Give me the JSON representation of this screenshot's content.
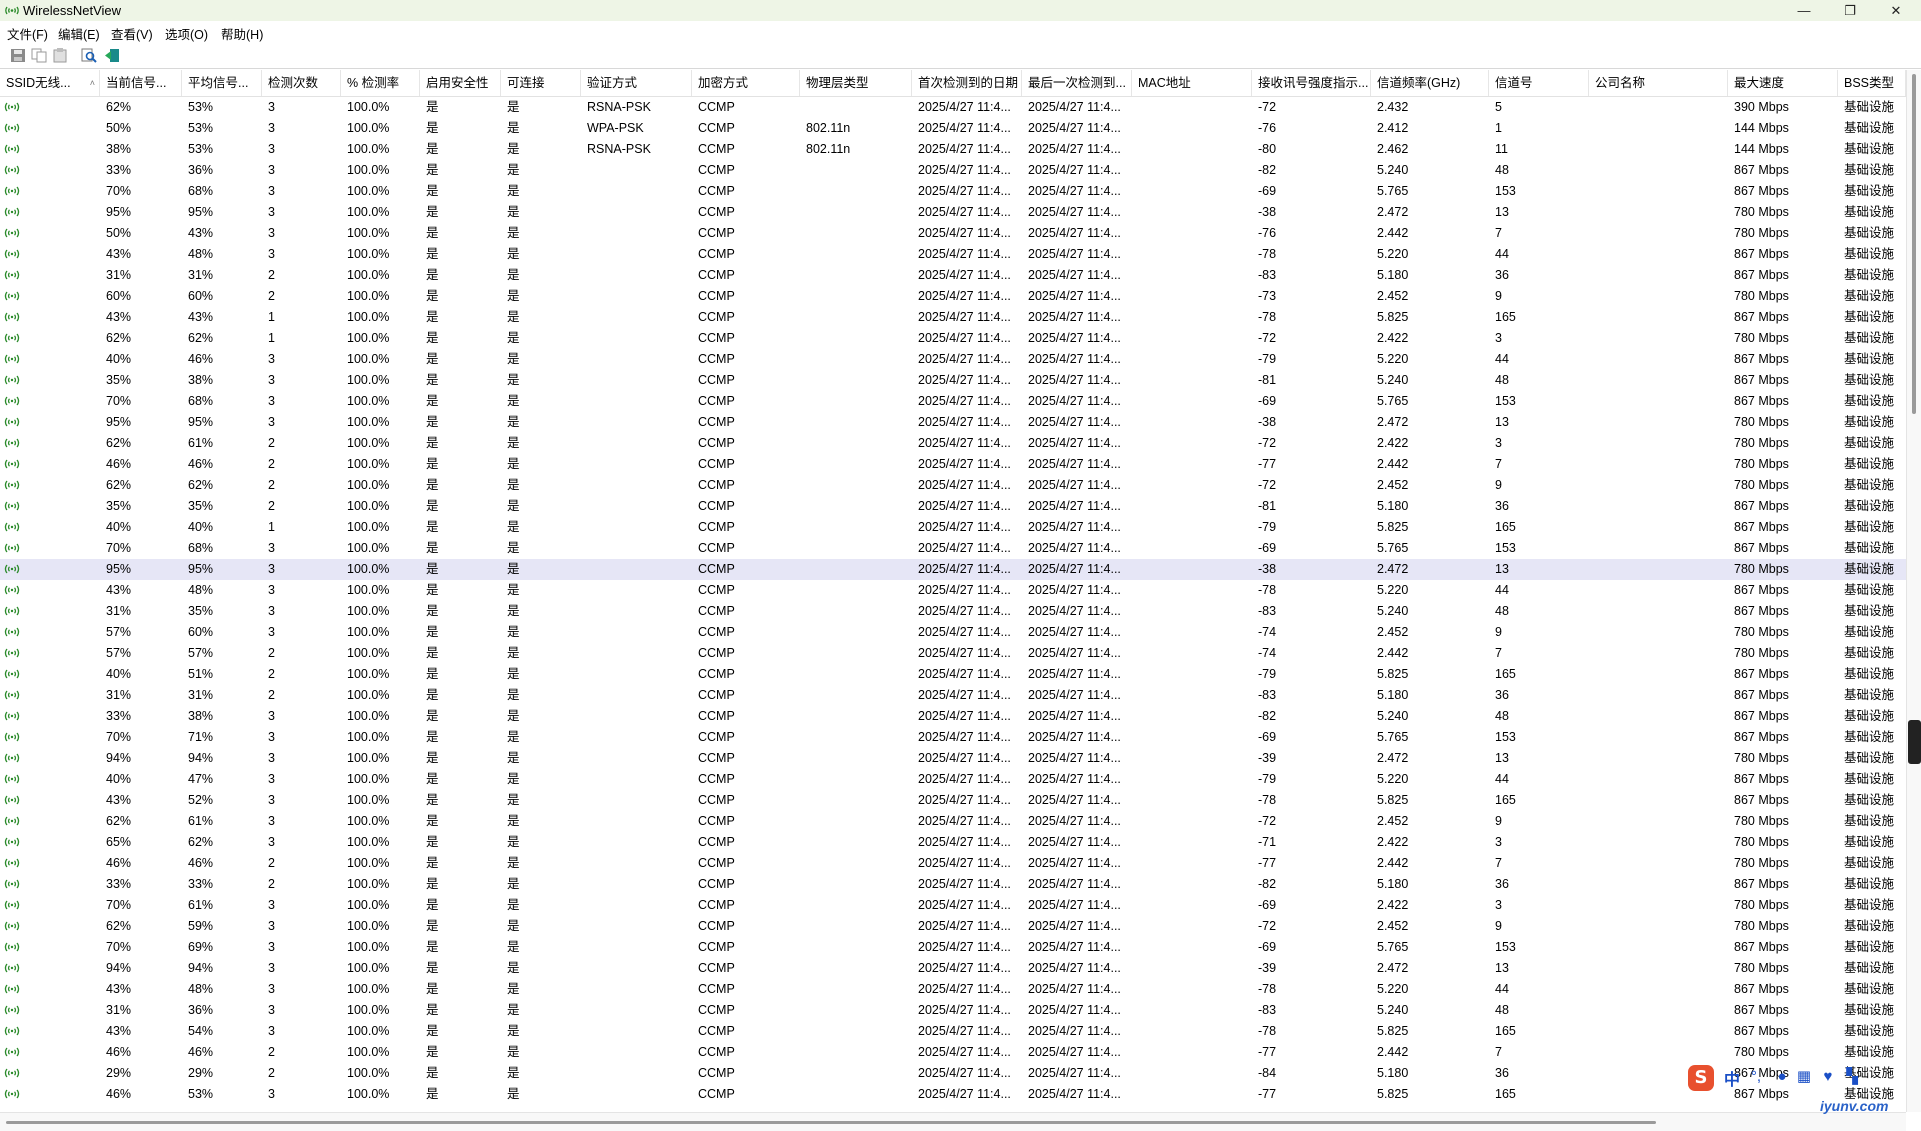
{
  "window": {
    "title": "WirelessNetView",
    "controls": {
      "minimize": "—",
      "maximize": "❐",
      "close": "✕"
    }
  },
  "menu": [
    "文件(F)",
    "编辑(E)",
    "查看(V)",
    "选项(O)",
    "帮助(H)"
  ],
  "toolbar": [
    "save-icon",
    "copy-icon",
    "properties-icon",
    "find-icon",
    "exit-icon"
  ],
  "columns": [
    "SSID无线...",
    "当前信号...",
    "平均信号...",
    "检测次数",
    "% 检测率",
    "启用安全性",
    "可连接",
    "验证方式",
    "加密方式",
    "物理层类型",
    "首次检测到的日期",
    "最后一次检测到...",
    "MAC地址",
    "接收讯号强度指示...",
    "信道频率(GHz)",
    "信道号",
    "公司名称",
    "最大速度",
    "BSS类型"
  ],
  "sort_indicator": "˄",
  "row_constants": {
    "rate": "100.0%",
    "security": "是",
    "connectable": "是",
    "first": "2025/4/27 11:4...",
    "last": "2025/4/27 11:4...",
    "bss": "基础设施"
  },
  "rows": [
    {
      "ssid": "",
      "cur": "62%",
      "avg": "53%",
      "cnt": "3",
      "auth": "RSNA-PSK",
      "enc": "CCMP",
      "phy": "",
      "rssi": "-72",
      "freq": "2.432",
      "ch": "5",
      "speed": "390 Mbps"
    },
    {
      "ssid": "",
      "cur": "50%",
      "avg": "53%",
      "cnt": "3",
      "auth": "WPA-PSK",
      "enc": "CCMP",
      "phy": "802.11n",
      "rssi": "-76",
      "freq": "2.412",
      "ch": "1",
      "speed": "144 Mbps"
    },
    {
      "ssid": "",
      "cur": "38%",
      "avg": "53%",
      "cnt": "3",
      "auth": "RSNA-PSK",
      "enc": "CCMP",
      "phy": "802.11n",
      "rssi": "-80",
      "freq": "2.462",
      "ch": "11",
      "speed": "144 Mbps"
    },
    {
      "ssid": "",
      "cur": "33%",
      "avg": "36%",
      "cnt": "3",
      "auth": "",
      "enc": "CCMP",
      "phy": "",
      "rssi": "-82",
      "freq": "5.240",
      "ch": "48",
      "speed": "867 Mbps"
    },
    {
      "ssid": "",
      "cur": "70%",
      "avg": "68%",
      "cnt": "3",
      "auth": "",
      "enc": "CCMP",
      "phy": "",
      "rssi": "-69",
      "freq": "5.765",
      "ch": "153",
      "speed": "867 Mbps"
    },
    {
      "ssid": "",
      "cur": "95%",
      "avg": "95%",
      "cnt": "3",
      "auth": "",
      "enc": "CCMP",
      "phy": "",
      "rssi": "-38",
      "freq": "2.472",
      "ch": "13",
      "speed": "780 Mbps"
    },
    {
      "ssid": "",
      "cur": "50%",
      "avg": "43%",
      "cnt": "3",
      "auth": "",
      "enc": "CCMP",
      "phy": "",
      "rssi": "-76",
      "freq": "2.442",
      "ch": "7",
      "speed": "780 Mbps"
    },
    {
      "ssid": "",
      "cur": "43%",
      "avg": "48%",
      "cnt": "3",
      "auth": "",
      "enc": "CCMP",
      "phy": "",
      "rssi": "-78",
      "freq": "5.220",
      "ch": "44",
      "speed": "867 Mbps"
    },
    {
      "ssid": "",
      "cur": "31%",
      "avg": "31%",
      "cnt": "2",
      "auth": "",
      "enc": "CCMP",
      "phy": "",
      "rssi": "-83",
      "freq": "5.180",
      "ch": "36",
      "speed": "867 Mbps"
    },
    {
      "ssid": "",
      "cur": "60%",
      "avg": "60%",
      "cnt": "2",
      "auth": "",
      "enc": "CCMP",
      "phy": "",
      "rssi": "-73",
      "freq": "2.452",
      "ch": "9",
      "speed": "780 Mbps"
    },
    {
      "ssid": "",
      "cur": "43%",
      "avg": "43%",
      "cnt": "1",
      "auth": "",
      "enc": "CCMP",
      "phy": "",
      "rssi": "-78",
      "freq": "5.825",
      "ch": "165",
      "speed": "867 Mbps"
    },
    {
      "ssid": "",
      "cur": "62%",
      "avg": "62%",
      "cnt": "1",
      "auth": "",
      "enc": "CCMP",
      "phy": "",
      "rssi": "-72",
      "freq": "2.422",
      "ch": "3",
      "speed": "780 Mbps"
    },
    {
      "ssid": "",
      "cur": "40%",
      "avg": "46%",
      "cnt": "3",
      "auth": "",
      "enc": "CCMP",
      "phy": "",
      "rssi": "-79",
      "freq": "5.220",
      "ch": "44",
      "speed": "867 Mbps"
    },
    {
      "ssid": "",
      "cur": "35%",
      "avg": "38%",
      "cnt": "3",
      "auth": "",
      "enc": "CCMP",
      "phy": "",
      "rssi": "-81",
      "freq": "5.240",
      "ch": "48",
      "speed": "867 Mbps"
    },
    {
      "ssid": "",
      "cur": "70%",
      "avg": "68%",
      "cnt": "3",
      "auth": "",
      "enc": "CCMP",
      "phy": "",
      "rssi": "-69",
      "freq": "5.765",
      "ch": "153",
      "speed": "867 Mbps"
    },
    {
      "ssid": "",
      "cur": "95%",
      "avg": "95%",
      "cnt": "3",
      "auth": "",
      "enc": "CCMP",
      "phy": "",
      "rssi": "-38",
      "freq": "2.472",
      "ch": "13",
      "speed": "780 Mbps"
    },
    {
      "ssid": "",
      "cur": "62%",
      "avg": "61%",
      "cnt": "2",
      "auth": "",
      "enc": "CCMP",
      "phy": "",
      "rssi": "-72",
      "freq": "2.422",
      "ch": "3",
      "speed": "780 Mbps"
    },
    {
      "ssid": "",
      "cur": "46%",
      "avg": "46%",
      "cnt": "2",
      "auth": "",
      "enc": "CCMP",
      "phy": "",
      "rssi": "-77",
      "freq": "2.442",
      "ch": "7",
      "speed": "780 Mbps"
    },
    {
      "ssid": "",
      "cur": "62%",
      "avg": "62%",
      "cnt": "2",
      "auth": "",
      "enc": "CCMP",
      "phy": "",
      "rssi": "-72",
      "freq": "2.452",
      "ch": "9",
      "speed": "780 Mbps"
    },
    {
      "ssid": "",
      "cur": "35%",
      "avg": "35%",
      "cnt": "2",
      "auth": "",
      "enc": "CCMP",
      "phy": "",
      "rssi": "-81",
      "freq": "5.180",
      "ch": "36",
      "speed": "867 Mbps"
    },
    {
      "ssid": "",
      "cur": "40%",
      "avg": "40%",
      "cnt": "1",
      "auth": "",
      "enc": "CCMP",
      "phy": "",
      "rssi": "-79",
      "freq": "5.825",
      "ch": "165",
      "speed": "867 Mbps"
    },
    {
      "ssid": "",
      "cur": "70%",
      "avg": "68%",
      "cnt": "3",
      "auth": "",
      "enc": "CCMP",
      "phy": "",
      "rssi": "-69",
      "freq": "5.765",
      "ch": "153",
      "speed": "867 Mbps"
    },
    {
      "ssid": "",
      "cur": "95%",
      "avg": "95%",
      "cnt": "3",
      "auth": "",
      "enc": "CCMP",
      "phy": "",
      "rssi": "-38",
      "freq": "2.472",
      "ch": "13",
      "speed": "780 Mbps",
      "selected": true
    },
    {
      "ssid": "",
      "cur": "43%",
      "avg": "48%",
      "cnt": "3",
      "auth": "",
      "enc": "CCMP",
      "phy": "",
      "rssi": "-78",
      "freq": "5.220",
      "ch": "44",
      "speed": "867 Mbps"
    },
    {
      "ssid": "",
      "cur": "31%",
      "avg": "35%",
      "cnt": "3",
      "auth": "",
      "enc": "CCMP",
      "phy": "",
      "rssi": "-83",
      "freq": "5.240",
      "ch": "48",
      "speed": "867 Mbps"
    },
    {
      "ssid": "",
      "cur": "57%",
      "avg": "60%",
      "cnt": "3",
      "auth": "",
      "enc": "CCMP",
      "phy": "",
      "rssi": "-74",
      "freq": "2.452",
      "ch": "9",
      "speed": "780 Mbps"
    },
    {
      "ssid": "",
      "cur": "57%",
      "avg": "57%",
      "cnt": "2",
      "auth": "",
      "enc": "CCMP",
      "phy": "",
      "rssi": "-74",
      "freq": "2.442",
      "ch": "7",
      "speed": "780 Mbps"
    },
    {
      "ssid": "",
      "cur": "40%",
      "avg": "51%",
      "cnt": "2",
      "auth": "",
      "enc": "CCMP",
      "phy": "",
      "rssi": "-79",
      "freq": "5.825",
      "ch": "165",
      "speed": "867 Mbps"
    },
    {
      "ssid": "",
      "cur": "31%",
      "avg": "31%",
      "cnt": "2",
      "auth": "",
      "enc": "CCMP",
      "phy": "",
      "rssi": "-83",
      "freq": "5.180",
      "ch": "36",
      "speed": "867 Mbps"
    },
    {
      "ssid": "",
      "cur": "33%",
      "avg": "38%",
      "cnt": "3",
      "auth": "",
      "enc": "CCMP",
      "phy": "",
      "rssi": "-82",
      "freq": "5.240",
      "ch": "48",
      "speed": "867 Mbps"
    },
    {
      "ssid": "",
      "cur": "70%",
      "avg": "71%",
      "cnt": "3",
      "auth": "",
      "enc": "CCMP",
      "phy": "",
      "rssi": "-69",
      "freq": "5.765",
      "ch": "153",
      "speed": "867 Mbps"
    },
    {
      "ssid": "",
      "cur": "94%",
      "avg": "94%",
      "cnt": "3",
      "auth": "",
      "enc": "CCMP",
      "phy": "",
      "rssi": "-39",
      "freq": "2.472",
      "ch": "13",
      "speed": "780 Mbps"
    },
    {
      "ssid": "",
      "cur": "40%",
      "avg": "47%",
      "cnt": "3",
      "auth": "",
      "enc": "CCMP",
      "phy": "",
      "rssi": "-79",
      "freq": "5.220",
      "ch": "44",
      "speed": "867 Mbps"
    },
    {
      "ssid": "",
      "cur": "43%",
      "avg": "52%",
      "cnt": "3",
      "auth": "",
      "enc": "CCMP",
      "phy": "",
      "rssi": "-78",
      "freq": "5.825",
      "ch": "165",
      "speed": "867 Mbps"
    },
    {
      "ssid": "",
      "cur": "62%",
      "avg": "61%",
      "cnt": "3",
      "auth": "",
      "enc": "CCMP",
      "phy": "",
      "rssi": "-72",
      "freq": "2.452",
      "ch": "9",
      "speed": "780 Mbps"
    },
    {
      "ssid": "",
      "cur": "65%",
      "avg": "62%",
      "cnt": "3",
      "auth": "",
      "enc": "CCMP",
      "phy": "",
      "rssi": "-71",
      "freq": "2.422",
      "ch": "3",
      "speed": "780 Mbps"
    },
    {
      "ssid": "",
      "cur": "46%",
      "avg": "46%",
      "cnt": "2",
      "auth": "",
      "enc": "CCMP",
      "phy": "",
      "rssi": "-77",
      "freq": "2.442",
      "ch": "7",
      "speed": "780 Mbps"
    },
    {
      "ssid": "",
      "cur": "33%",
      "avg": "33%",
      "cnt": "2",
      "auth": "",
      "enc": "CCMP",
      "phy": "",
      "rssi": "-82",
      "freq": "5.180",
      "ch": "36",
      "speed": "867 Mbps"
    },
    {
      "ssid": "",
      "cur": "70%",
      "avg": "61%",
      "cnt": "3",
      "auth": "",
      "enc": "CCMP",
      "phy": "",
      "rssi": "-69",
      "freq": "2.422",
      "ch": "3",
      "speed": "780 Mbps"
    },
    {
      "ssid": "",
      "cur": "62%",
      "avg": "59%",
      "cnt": "3",
      "auth": "",
      "enc": "CCMP",
      "phy": "",
      "rssi": "-72",
      "freq": "2.452",
      "ch": "9",
      "speed": "780 Mbps"
    },
    {
      "ssid": "",
      "cur": "70%",
      "avg": "69%",
      "cnt": "3",
      "auth": "",
      "enc": "CCMP",
      "phy": "",
      "rssi": "-69",
      "freq": "5.765",
      "ch": "153",
      "speed": "867 Mbps"
    },
    {
      "ssid": "",
      "cur": "94%",
      "avg": "94%",
      "cnt": "3",
      "auth": "",
      "enc": "CCMP",
      "phy": "",
      "rssi": "-39",
      "freq": "2.472",
      "ch": "13",
      "speed": "780 Mbps"
    },
    {
      "ssid": "",
      "cur": "43%",
      "avg": "48%",
      "cnt": "3",
      "auth": "",
      "enc": "CCMP",
      "phy": "",
      "rssi": "-78",
      "freq": "5.220",
      "ch": "44",
      "speed": "867 Mbps"
    },
    {
      "ssid": "",
      "cur": "31%",
      "avg": "36%",
      "cnt": "3",
      "auth": "",
      "enc": "CCMP",
      "phy": "",
      "rssi": "-83",
      "freq": "5.240",
      "ch": "48",
      "speed": "867 Mbps"
    },
    {
      "ssid": "",
      "cur": "43%",
      "avg": "54%",
      "cnt": "3",
      "auth": "",
      "enc": "CCMP",
      "phy": "",
      "rssi": "-78",
      "freq": "5.825",
      "ch": "165",
      "speed": "867 Mbps"
    },
    {
      "ssid": "",
      "cur": "46%",
      "avg": "46%",
      "cnt": "2",
      "auth": "",
      "enc": "CCMP",
      "phy": "",
      "rssi": "-77",
      "freq": "2.442",
      "ch": "7",
      "speed": "780 Mbps"
    },
    {
      "ssid": "",
      "cur": "29%",
      "avg": "29%",
      "cnt": "2",
      "auth": "",
      "enc": "CCMP",
      "phy": "",
      "rssi": "-84",
      "freq": "5.180",
      "ch": "36",
      "speed": "867 Mbps"
    },
    {
      "ssid": "",
      "cur": "46%",
      "avg": "53%",
      "cnt": "3",
      "auth": "",
      "enc": "CCMP",
      "phy": "",
      "rssi": "-77",
      "freq": "5.825",
      "ch": "165",
      "speed": "867 Mbps"
    }
  ],
  "ime": {
    "language": "中",
    "watermark": "iyunv.com"
  },
  "colors": {
    "titlebar": "#eef5e6",
    "selected_row": "#e6e6f6",
    "signal_icon": "#2a8a2a",
    "ime_blue": "#1a4fc6",
    "ime_logo": "#e8502e"
  }
}
